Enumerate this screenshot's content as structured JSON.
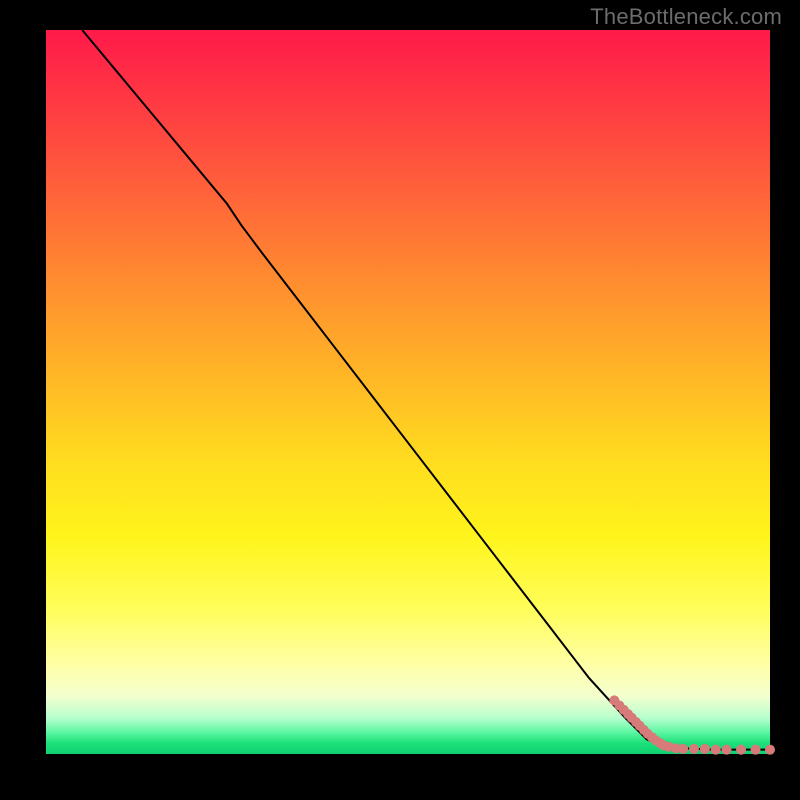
{
  "watermark": "TheBottleneck.com",
  "chart_data": {
    "type": "line",
    "title": "",
    "xlabel": "",
    "ylabel": "",
    "xlim": [
      0,
      100
    ],
    "ylim": [
      0,
      100
    ],
    "grid": false,
    "legend": false,
    "series": [
      {
        "name": "curve",
        "x": [
          5,
          10,
          15,
          20,
          25,
          27,
          30,
          35,
          40,
          45,
          50,
          55,
          60,
          65,
          70,
          75,
          80,
          83,
          85,
          88,
          90,
          92,
          94,
          96,
          98,
          100
        ],
        "y": [
          100,
          94,
          88,
          82,
          76,
          73,
          69,
          62.5,
          56,
          49.5,
          43,
          36.5,
          30,
          23.5,
          17,
          10.5,
          5,
          2,
          1.2,
          0.8,
          0.7,
          0.6,
          0.6,
          0.6,
          0.6,
          0.6
        ],
        "stroke": "#000000",
        "stroke_width": 2
      }
    ],
    "scatter": {
      "name": "points",
      "color": "#d67a7a",
      "radius": 5,
      "x": [
        78.5,
        79.2,
        79.8,
        80.4,
        80.9,
        81.5,
        82.0,
        82.6,
        83.1,
        83.7,
        84.2,
        84.8,
        85.3,
        86.0,
        87.0,
        88.0,
        89.5,
        91.0,
        92.5,
        94.0,
        96.0,
        98.0,
        100.0
      ],
      "y": [
        7.4,
        6.7,
        6.1,
        5.5,
        5.0,
        4.4,
        3.9,
        3.3,
        2.8,
        2.3,
        1.9,
        1.5,
        1.2,
        1.0,
        0.8,
        0.7,
        0.7,
        0.7,
        0.6,
        0.6,
        0.6,
        0.6,
        0.6
      ]
    }
  }
}
